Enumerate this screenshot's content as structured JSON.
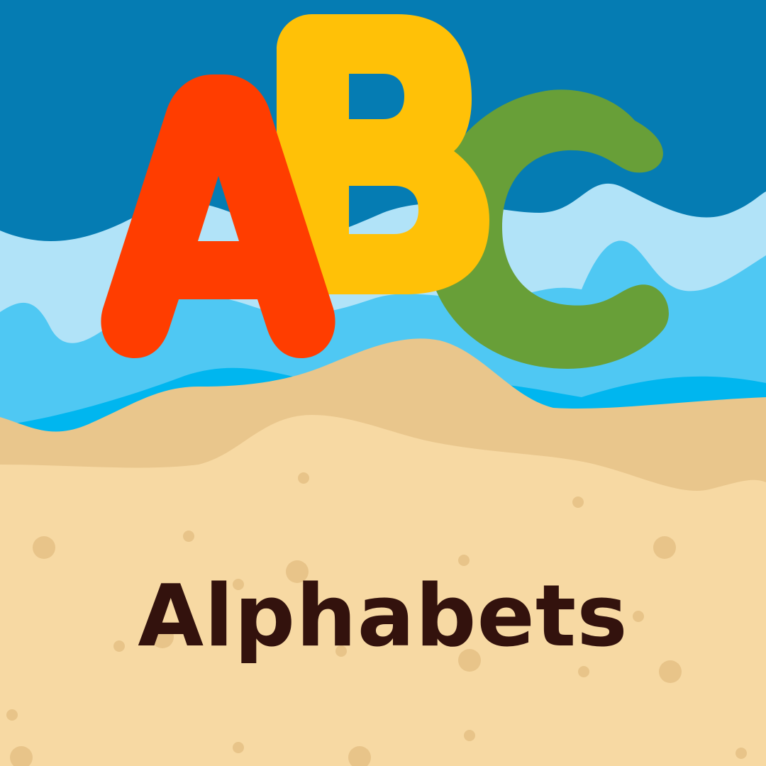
{
  "title": "Alphabets",
  "letters": [
    {
      "char": "A",
      "color": "#ff3d00"
    },
    {
      "char": "B",
      "color": "#ffc107"
    },
    {
      "char": "C",
      "color": "#689f38"
    }
  ],
  "colors": {
    "sky": "#057cb3",
    "wave_light": "#b1e3f8",
    "wave_mid": "#4fc8f3",
    "wave_bright": "#00b6ef",
    "sand_dark": "#e9c68c",
    "sand_light": "#f7d9a3",
    "sand_dots": "#e8c489",
    "text": "#33120d"
  }
}
